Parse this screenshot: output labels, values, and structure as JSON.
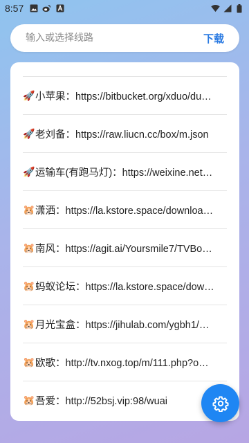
{
  "status_bar": {
    "time": "8:57",
    "left_icons": [
      "image-icon",
      "weibo-icon",
      "app-a-icon"
    ],
    "right_icons": [
      "wifi-icon",
      "signal-icon",
      "battery-icon"
    ]
  },
  "search": {
    "placeholder": "输入或选择线路",
    "value": "",
    "download_label": "下载",
    "accent_color": "#2a7ae2"
  },
  "routes": [
    {
      "icon": "🚀",
      "icon_name": "rocket-icon",
      "text": "小苹果：https://bitbucket.org/xduo/du…"
    },
    {
      "icon": "🚀",
      "icon_name": "rocket-icon",
      "text": "老刘备：https://raw.liucn.cc/box/m.json"
    },
    {
      "icon": "🚀",
      "icon_name": "rocket-icon",
      "text": "运输车(有跑马灯)：https://weixine.net…"
    },
    {
      "icon": "🐹",
      "icon_name": "hamster-icon",
      "text": "潇洒：https://la.kstore.space/downloa…"
    },
    {
      "icon": "🐹",
      "icon_name": "hamster-icon",
      "text": "南风：https://agit.ai/Yoursmile7/TVBo…"
    },
    {
      "icon": "🐹",
      "icon_name": "hamster-icon",
      "text": "蚂蚁论坛：https://la.kstore.space/dow…"
    },
    {
      "icon": "🐹",
      "icon_name": "hamster-icon",
      "text": "月光宝盒：https://jihulab.com/ygbh1/…"
    },
    {
      "icon": "🐹",
      "icon_name": "hamster-icon",
      "text": "欧歌：http://tv.nxog.top/m/111.php?o…"
    },
    {
      "icon": "🐹",
      "icon_name": "hamster-icon",
      "text": "吾爱：http://52bsj.vip:98/wuai"
    }
  ],
  "fab": {
    "icon": "gear-icon",
    "color": "#1f86f3"
  }
}
